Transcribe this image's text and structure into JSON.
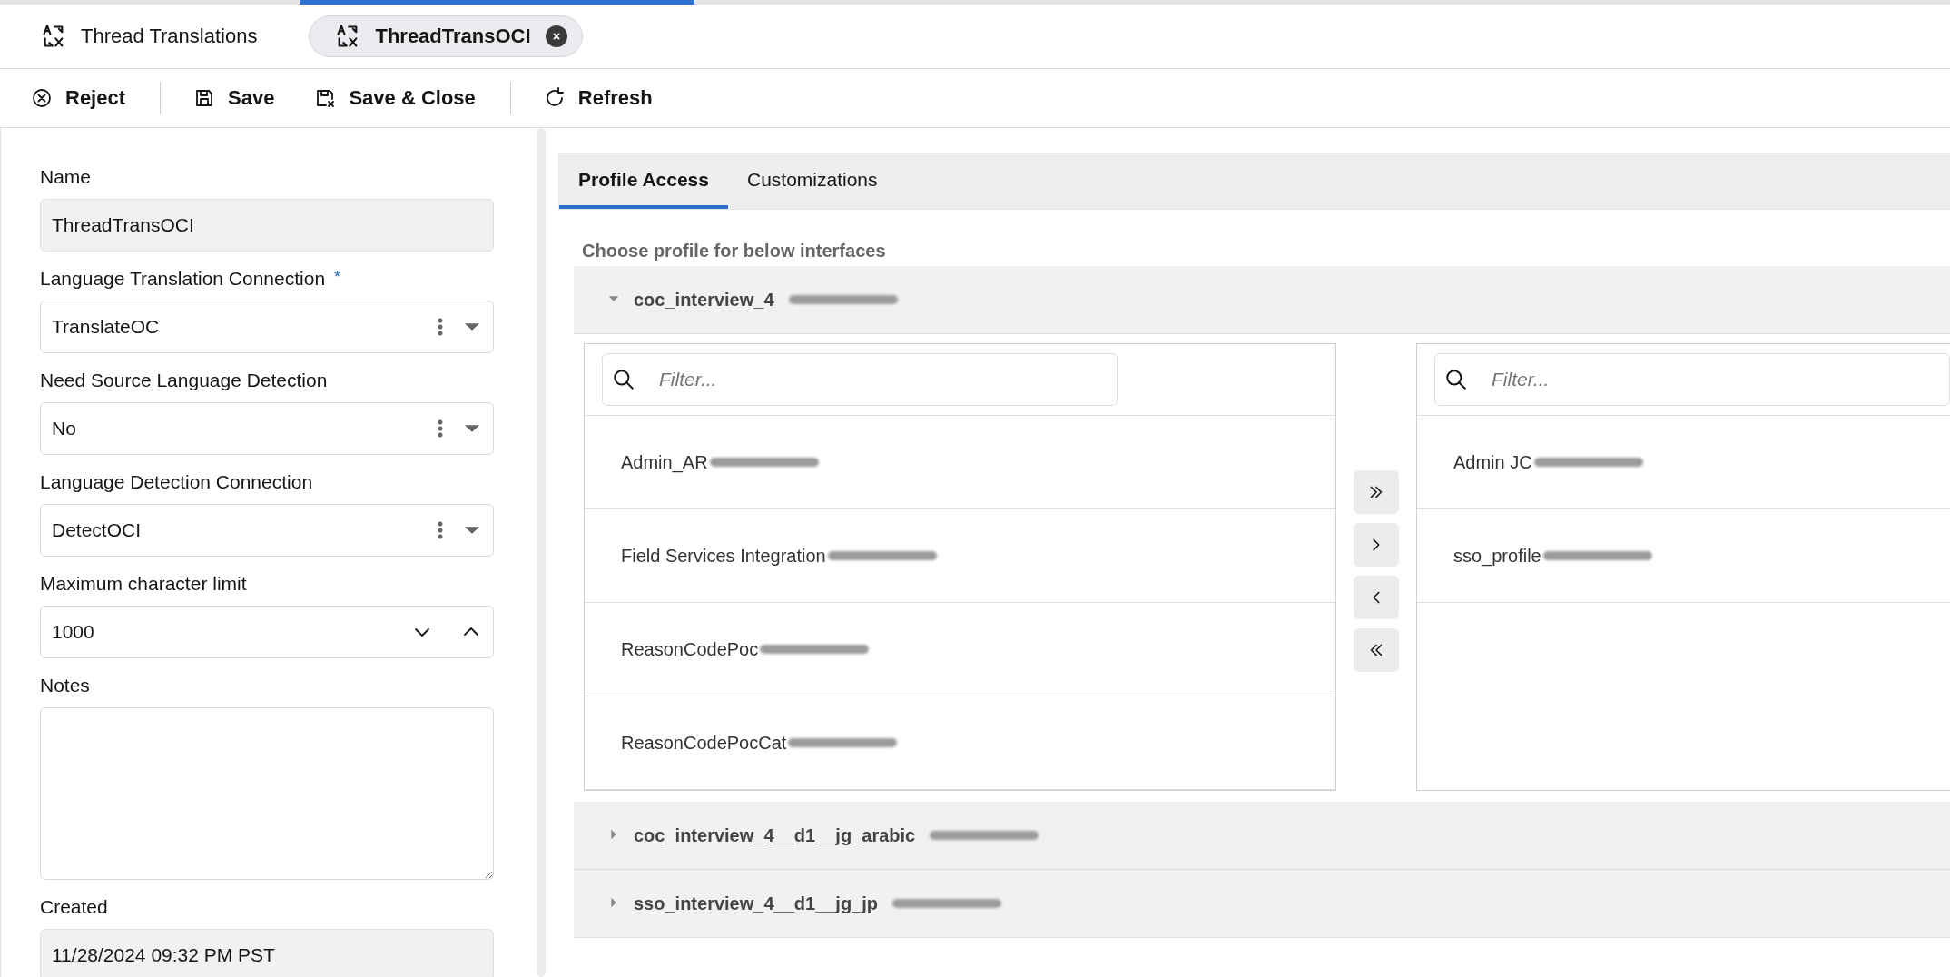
{
  "app_tabs": [
    {
      "label": "Thread Translations",
      "selected": false,
      "closable": false
    },
    {
      "label": "ThreadTransOCI",
      "selected": true,
      "closable": true
    }
  ],
  "toolbar": [
    {
      "label": "Reject",
      "kind": "reject",
      "separator_after": true
    },
    {
      "label": "Save",
      "kind": "save",
      "separator_after": false
    },
    {
      "label": "Save & Close",
      "kind": "save-close",
      "separator_after": true
    },
    {
      "label": "Refresh",
      "kind": "refresh",
      "separator_after": false
    }
  ],
  "form": {
    "fields": [
      {
        "kind": "readonly",
        "label": "Name",
        "value": "ThreadTransOCI"
      },
      {
        "kind": "select",
        "label": "Language Translation Connection",
        "required_mark": "*",
        "value": "TranslateOC"
      },
      {
        "kind": "select",
        "label": "Need Source Language Detection",
        "value": "No"
      },
      {
        "kind": "select",
        "label": "Language Detection Connection",
        "value": "DetectOCI"
      },
      {
        "kind": "number",
        "label": "Maximum character limit",
        "value": "1000"
      },
      {
        "kind": "textarea",
        "label": "Notes"
      },
      {
        "kind": "readonly",
        "label": "Created",
        "value": "11/28/2024 09:32 PM PST"
      }
    ]
  },
  "detail_tabs": [
    {
      "label": "Profile Access",
      "selected": true
    },
    {
      "label": "Customizations",
      "selected": false
    }
  ],
  "profile_access": {
    "heading": "Choose profile for below interfaces",
    "interfaces": [
      {
        "name": "coc_interview_4",
        "redacted": true,
        "expanded": true,
        "available": {
          "placeholder": "Filter...",
          "items": [
            {
              "label": "Admin_AR",
              "redacted": true
            },
            {
              "label": "Field Services Integration",
              "redacted": true
            },
            {
              "label": "ReasonCodePoc",
              "redacted": true
            },
            {
              "label": "ReasonCodePocCat",
              "redacted": true
            }
          ]
        },
        "chosen": {
          "placeholder": "Filter...",
          "items": [
            {
              "label": "Admin JC",
              "redacted": true
            },
            {
              "label": "sso_profile",
              "redacted": true
            }
          ]
        }
      },
      {
        "name": "coc_interview_4__d1__jg_arabic",
        "redacted": true,
        "expanded": false
      },
      {
        "name": "sso_interview_4__d1__jg_jp",
        "redacted": true,
        "expanded": false
      }
    ]
  }
}
